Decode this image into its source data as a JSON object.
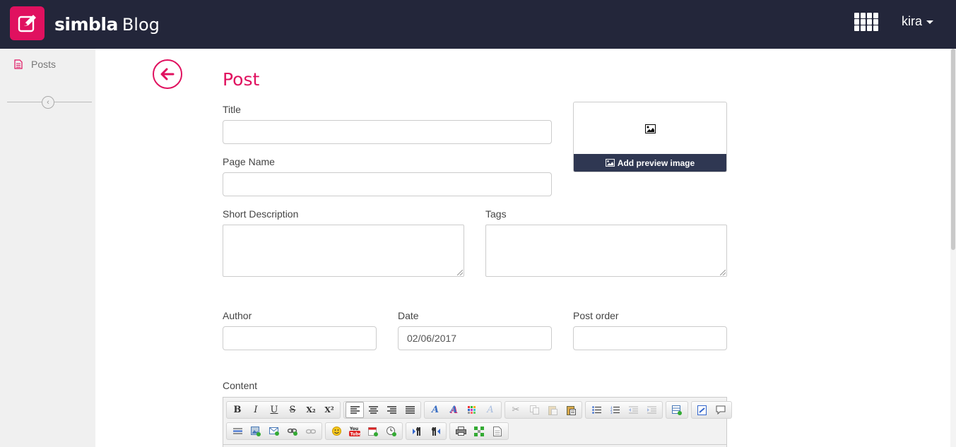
{
  "header": {
    "brand_name": "simbla",
    "brand_product": "Blog",
    "user_name": "kira"
  },
  "sidebar": {
    "items": [
      {
        "label": "Posts"
      }
    ]
  },
  "page": {
    "title": "Post"
  },
  "form": {
    "title_label": "Title",
    "title_value": "",
    "page_name_label": "Page Name",
    "page_name_value": "",
    "short_description_label": "Short Description",
    "tags_label": "Tags",
    "author_label": "Author",
    "author_value": "",
    "date_label": "Date",
    "date_value": "02/06/2017",
    "post_order_label": "Post order",
    "post_order_value": "",
    "content_label": "Content",
    "preview_button_label": "Add preview image"
  },
  "toolbar": {
    "row1": [
      [
        "B",
        "I",
        "U",
        "S",
        "X₂",
        "X²"
      ],
      [
        "align-left-icon",
        "align-center-icon",
        "align-right-icon",
        "align-justify-icon"
      ],
      [
        "text-color-icon",
        "background-color-icon",
        "color-palette-icon",
        "remove-format-icon"
      ],
      [
        "cut-icon",
        "copy-icon",
        "paste-icon",
        "paste-text-icon"
      ],
      [
        "bullet-list-icon",
        "numbered-list-icon",
        "outdent-icon",
        "indent-icon"
      ],
      [
        "insert-table-icon"
      ],
      [
        "source-icon",
        "comment-icon"
      ]
    ],
    "row2": [
      [
        "horizontal-rule-icon",
        "insert-image-icon",
        "email-link-icon",
        "insert-link-icon",
        "unlink-icon"
      ],
      [
        "emoji-icon",
        "youtube-icon",
        "calendar-icon",
        "clock-icon"
      ],
      [
        "ltr-icon",
        "rtl-icon"
      ],
      [
        "print-icon",
        "select-all-icon",
        "new-page-icon"
      ]
    ]
  },
  "colors": {
    "accent": "#e0115f",
    "header_bg": "#23263a",
    "preview_bar_bg": "#2f3752",
    "sidebar_bg": "#f0f0f0"
  }
}
